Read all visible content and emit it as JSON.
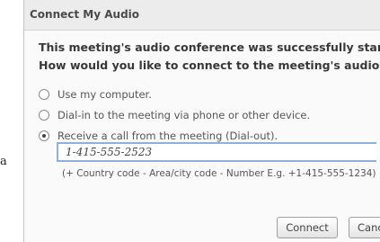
{
  "side_fragment": "a",
  "dialog": {
    "title": "Connect My Audio",
    "prompt_line1": "This meeting's audio conference was successfully started.",
    "prompt_line2": "How would you like to connect to the meeting's audio?",
    "options": [
      {
        "label": "Use my computer.",
        "selected": false
      },
      {
        "label": "Dial-in to the meeting via phone or other device.",
        "selected": false
      },
      {
        "label": "Receive a call from the meeting (Dial-out).",
        "selected": true
      }
    ],
    "phone_value": "1-415-555-2523",
    "hint": "(+ Country code - Area/city code - Number E.g. +1-415-555-1234)",
    "connect_label": "Connect",
    "cancel_label": "Cancel"
  }
}
